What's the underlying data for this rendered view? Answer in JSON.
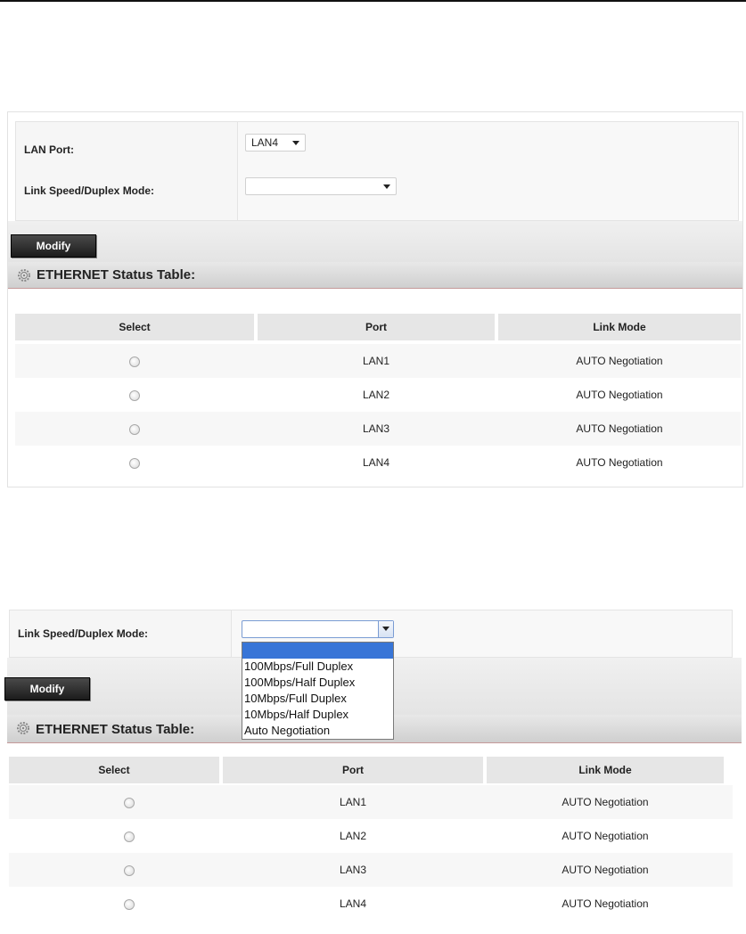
{
  "section1": {
    "lan_port_label": "LAN Port:",
    "lan_port_value": "LAN4",
    "link_speed_label": "Link Speed/Duplex Mode:",
    "link_speed_value": "",
    "modify_label": "Modify",
    "status_title": "ETHERNET Status Table:",
    "columns": [
      "Select",
      "Port",
      "Link Mode"
    ],
    "rows": [
      {
        "port": "LAN1",
        "mode": "AUTO Negotiation"
      },
      {
        "port": "LAN2",
        "mode": "AUTO Negotiation"
      },
      {
        "port": "LAN3",
        "mode": "AUTO Negotiation"
      },
      {
        "port": "LAN4",
        "mode": "AUTO Negotiation"
      }
    ]
  },
  "section2": {
    "link_speed_label": "Link Speed/Duplex Mode:",
    "link_speed_value": "",
    "dropdown_options": [
      "",
      "100Mbps/Full Duplex",
      "100Mbps/Half Duplex",
      "10Mbps/Full Duplex",
      "10Mbps/Half Duplex",
      "Auto Negotiation"
    ],
    "modify_label": "Modify",
    "status_title": "ETHERNET Status Table:",
    "columns": [
      "Select",
      "Port",
      "Link Mode"
    ],
    "rows": [
      {
        "port": "LAN1",
        "mode": "AUTO Negotiation"
      },
      {
        "port": "LAN2",
        "mode": "AUTO Negotiation"
      },
      {
        "port": "LAN3",
        "mode": "AUTO Negotiation"
      },
      {
        "port": "LAN4",
        "mode": "AUTO Negotiation"
      }
    ]
  },
  "icons": {
    "section_icon": "gear-icon",
    "select_arrow": "chevron-down-icon"
  }
}
